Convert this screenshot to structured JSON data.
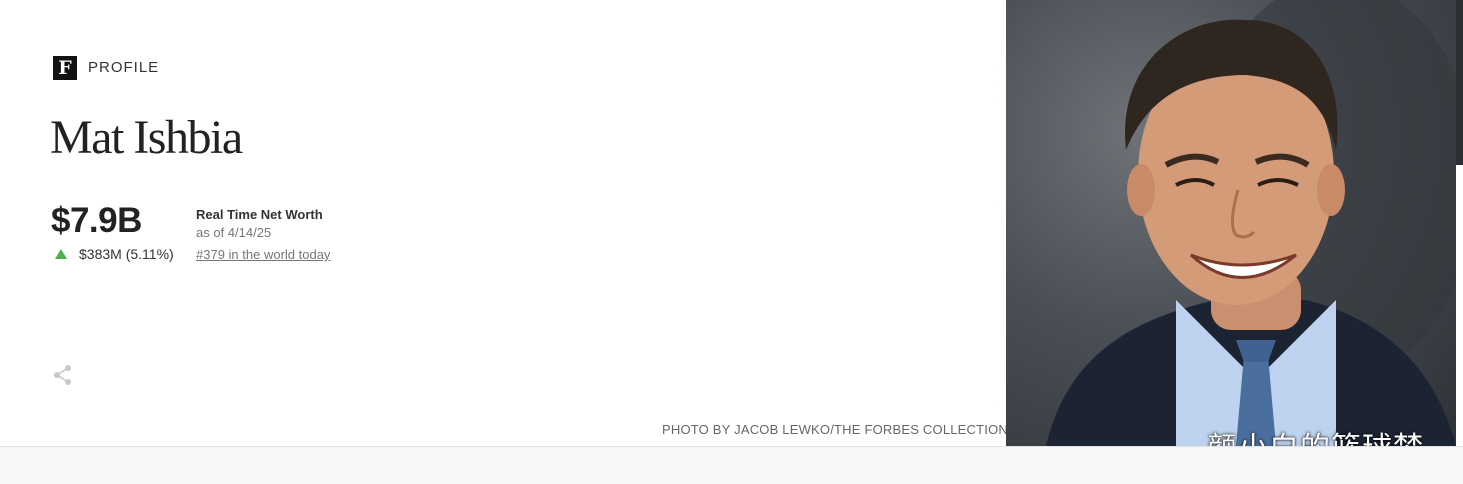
{
  "brand": {
    "logo_letter": "F",
    "section_label": "PROFILE"
  },
  "profile": {
    "name": "Mat Ishbia",
    "net_worth": "$7.9B",
    "net_worth_label": "Real Time Net Worth",
    "as_of": "as of 4/14/25",
    "change": "$383M (5.11%)",
    "change_direction": "up",
    "rank_text": "#379 in the world today"
  },
  "photo": {
    "credit": "PHOTO BY JACOB LEWKO/THE FORBES COLLECTION",
    "subject": "portrait-photo"
  },
  "watermark": "颜小白的篮球梦",
  "icons": {
    "share": "share-icon",
    "logo": "forbes-logo-icon",
    "change": "up-arrow-icon"
  },
  "colors": {
    "accent_up": "#4caf50",
    "text": "#222222",
    "muted": "#767676"
  }
}
